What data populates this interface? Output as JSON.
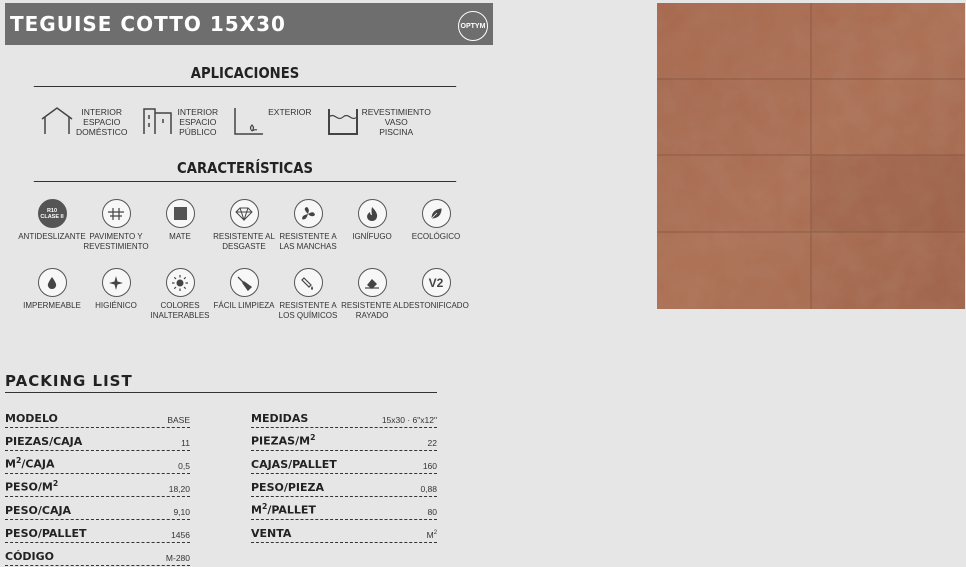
{
  "header": {
    "title": "TEGUISE COTTO 15X30",
    "logo": "OPTYM"
  },
  "aplicaciones": {
    "title": "APLICACIONES",
    "items": [
      {
        "icon": "house-icon",
        "label": "INTERIOR\nESPACIO\nDOMÉSTICO"
      },
      {
        "icon": "building-icon",
        "label": "INTERIOR\nESPACIO\nPÚBLICO"
      },
      {
        "icon": "exterior-icon",
        "label": "EXTERIOR"
      },
      {
        "icon": "pool-icon",
        "label": "REVESTIMIENTO\nVASO\nPISCINA"
      }
    ]
  },
  "caracteristicas": {
    "title": "CARACTERÍSTICAS",
    "row1": [
      {
        "icon": "r10-icon",
        "label": "ANTIDESLIZANTE",
        "badge_top": "R10",
        "badge_bottom": "CLASE II"
      },
      {
        "icon": "floor-icon",
        "label": "PAVIMENTO Y\nREVESTIMIENTO"
      },
      {
        "icon": "matte-icon",
        "label": "MATE"
      },
      {
        "icon": "diamond-icon",
        "label": "RESISTENTE AL\nDESGASTE"
      },
      {
        "icon": "stain-icon",
        "label": "RESISTENTE A\nLAS MANCHAS"
      },
      {
        "icon": "flame-icon",
        "label": "IGNÍFUGO"
      },
      {
        "icon": "leaf-icon",
        "label": "ECOLÓGICO"
      }
    ],
    "row2": [
      {
        "icon": "drop-icon",
        "label": "IMPERMEABLE"
      },
      {
        "icon": "sparkle-icon",
        "label": "HIGIÉNICO"
      },
      {
        "icon": "sun-icon",
        "label": "COLORES\nINALTERABLES"
      },
      {
        "icon": "brush-icon",
        "label": "FÁCIL LIMPIEZA"
      },
      {
        "icon": "chemical-icon",
        "label": "RESISTENTE A\nLOS QUÍMICOS"
      },
      {
        "icon": "scratch-icon",
        "label": "RESISTENTE AL\nRAYADO"
      },
      {
        "icon": "v2-icon",
        "label": "DESTONIFICADO",
        "glyph": "V2"
      }
    ]
  },
  "packing": {
    "title": "PACKING LIST",
    "left": [
      {
        "key": "MODELO",
        "value": "BASE"
      },
      {
        "key": "PIEZAS/CAJA",
        "value": "11"
      },
      {
        "key": "M2/CAJA",
        "value": "0,5"
      },
      {
        "key": "PESO/M2",
        "value": "18,20"
      },
      {
        "key": "PESO/CAJA",
        "value": "9,10"
      },
      {
        "key": "PESO/PALLET",
        "value": "1456"
      },
      {
        "key": "CÓDIGO",
        "value": "M-280"
      }
    ],
    "right": [
      {
        "key": "MEDIDAS",
        "value": "15x30 · 6\"x12\""
      },
      {
        "key": "PIEZAS/M2",
        "value": "22"
      },
      {
        "key": "CAJAS/PALLET",
        "value": "160"
      },
      {
        "key": "PESO/PIEZA",
        "value": "0,88"
      },
      {
        "key": "M2/PALLET",
        "value": "80"
      },
      {
        "key": "VENTA",
        "value": "M2"
      }
    ]
  },
  "colors": {
    "header_bg": "#6e6e6e",
    "tile": "#a8684e"
  }
}
